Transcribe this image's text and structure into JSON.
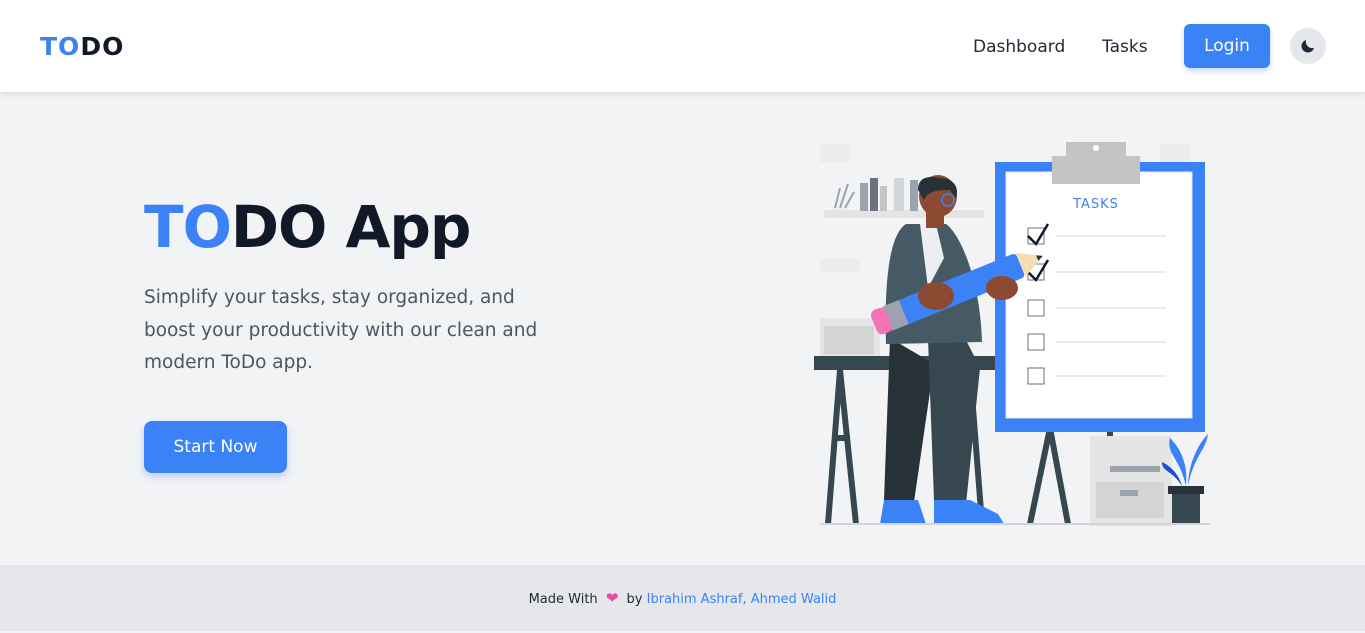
{
  "navbar": {
    "logo_part1": "TO",
    "logo_part2": "DO",
    "links": [
      {
        "label": "Dashboard"
      },
      {
        "label": "Tasks"
      }
    ],
    "login_label": "Login",
    "theme_icon": "moon-icon"
  },
  "hero": {
    "title_part1": "TO",
    "title_part2": "DO App",
    "description": "Simplify your tasks, stay organized, and boost your productivity with our clean and modern ToDo app.",
    "cta_label": "Start Now",
    "illustration": {
      "clipboard_title": "TASKS",
      "accent_color": "#3b82f6"
    }
  },
  "footer": {
    "made_with": "Made With",
    "heart_icon": "heart-icon",
    "by": "by",
    "authors": "Ibrahim Ashraf, Ahmed Walid"
  },
  "colors": {
    "brand": "#3b82f6",
    "text_dark": "#111827",
    "background": "#f2f3f5",
    "footer_bg": "#e5e7eb"
  }
}
